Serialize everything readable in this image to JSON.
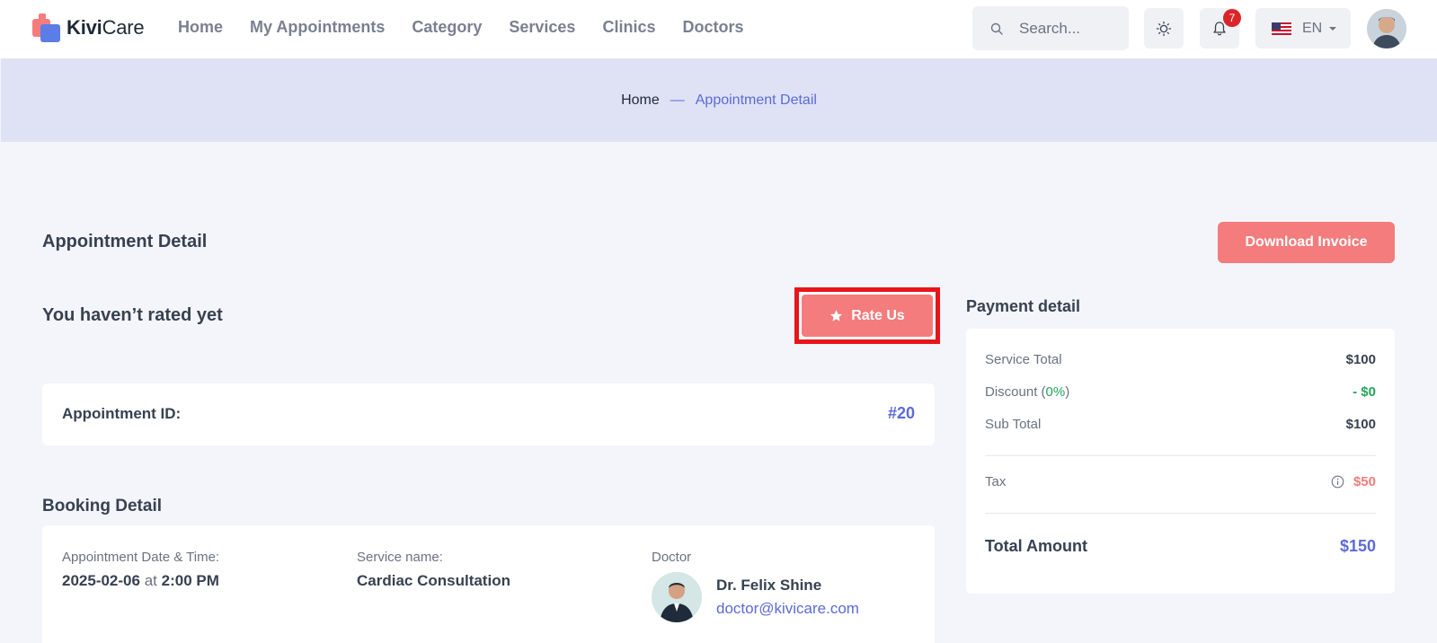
{
  "header": {
    "logo": {
      "part1": "Kivi",
      "part2": "Care"
    },
    "nav": [
      "Home",
      "My Appointments",
      "Category",
      "Services",
      "Clinics",
      "Doctors"
    ],
    "search": {
      "placeholder": "Search..."
    },
    "notifications_count": "7",
    "language": "EN",
    "colors": {
      "accent": "#5b6bd6",
      "primary": "#f47c7c"
    }
  },
  "breadcrumb": {
    "home": "Home",
    "separator": "—",
    "current": "Appointment Detail"
  },
  "main": {
    "page_title": "Appointment Detail",
    "download_label": "Download Invoice",
    "rated_text": "You haven’t rated yet",
    "rate_label": "Rate Us",
    "appointment": {
      "label": "Appointment ID:",
      "value": "#20"
    },
    "booking": {
      "title": "Booking Detail",
      "datetime_label": "Appointment Date & Time:",
      "date": "2025-02-06",
      "at": "at",
      "time": "2:00 PM",
      "service_label": "Service name:",
      "service": "Cardiac Consultation",
      "doctor_label": "Doctor",
      "doctor_name": "Dr. Felix Shine",
      "doctor_email": "doctor@kivicare.com"
    }
  },
  "payment": {
    "title": "Payment detail",
    "service_total_label": "Service Total",
    "service_total": "$100",
    "discount_label": "Discount",
    "discount_open": "(",
    "discount_percent": "0%",
    "discount_close": ")",
    "discount_value": "- $0",
    "subtotal_label": "Sub Total",
    "subtotal": "$100",
    "tax_label": "Tax",
    "tax": "$50",
    "total_label": "Total Amount",
    "total": "$150"
  }
}
